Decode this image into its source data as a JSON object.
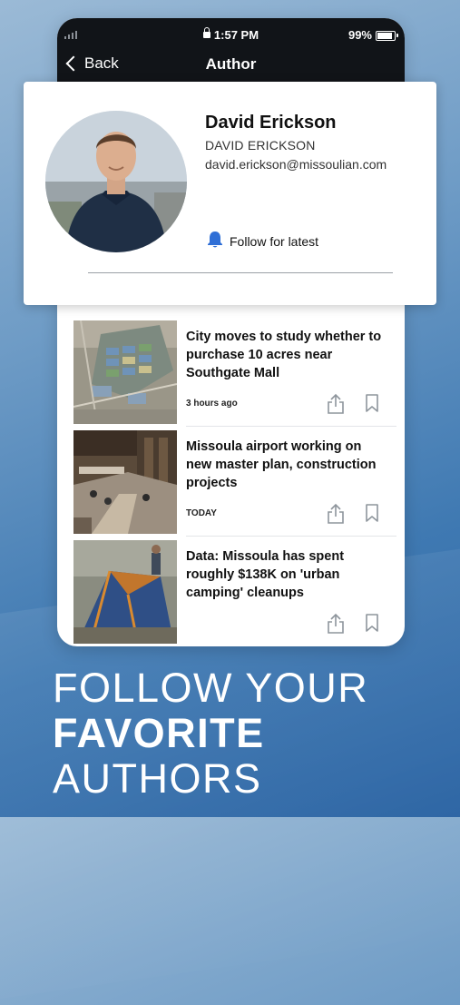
{
  "status_bar": {
    "time": "1:57 PM",
    "battery": "99%"
  },
  "nav": {
    "back_label": "Back",
    "title": "Author"
  },
  "author": {
    "name": "David Erickson",
    "name_caps": "DAVID ERICKSON",
    "email": "david.erickson@missoulian.com",
    "follow_label": "Follow for latest"
  },
  "articles": [
    {
      "title": "City moves to study whether to purchase 10 acres near Southgate Mall",
      "time": "3 hours ago"
    },
    {
      "title": "Missoula airport working on new master plan, construction projects",
      "time": "TODAY"
    },
    {
      "title": "Data: Missoula has spent roughly $138K on 'urban camping' cleanups",
      "time": ""
    }
  ],
  "promo": {
    "line1": "FOLLOW YOUR",
    "line2": "FAVORITE",
    "line3": "AUTHORS"
  },
  "colors": {
    "accent": "#2f6fd6",
    "nav_bg": "#111418"
  },
  "icons": [
    "lock-icon",
    "battery-icon",
    "chevron-left-icon",
    "bell-icon",
    "share-icon",
    "bookmark-icon"
  ]
}
